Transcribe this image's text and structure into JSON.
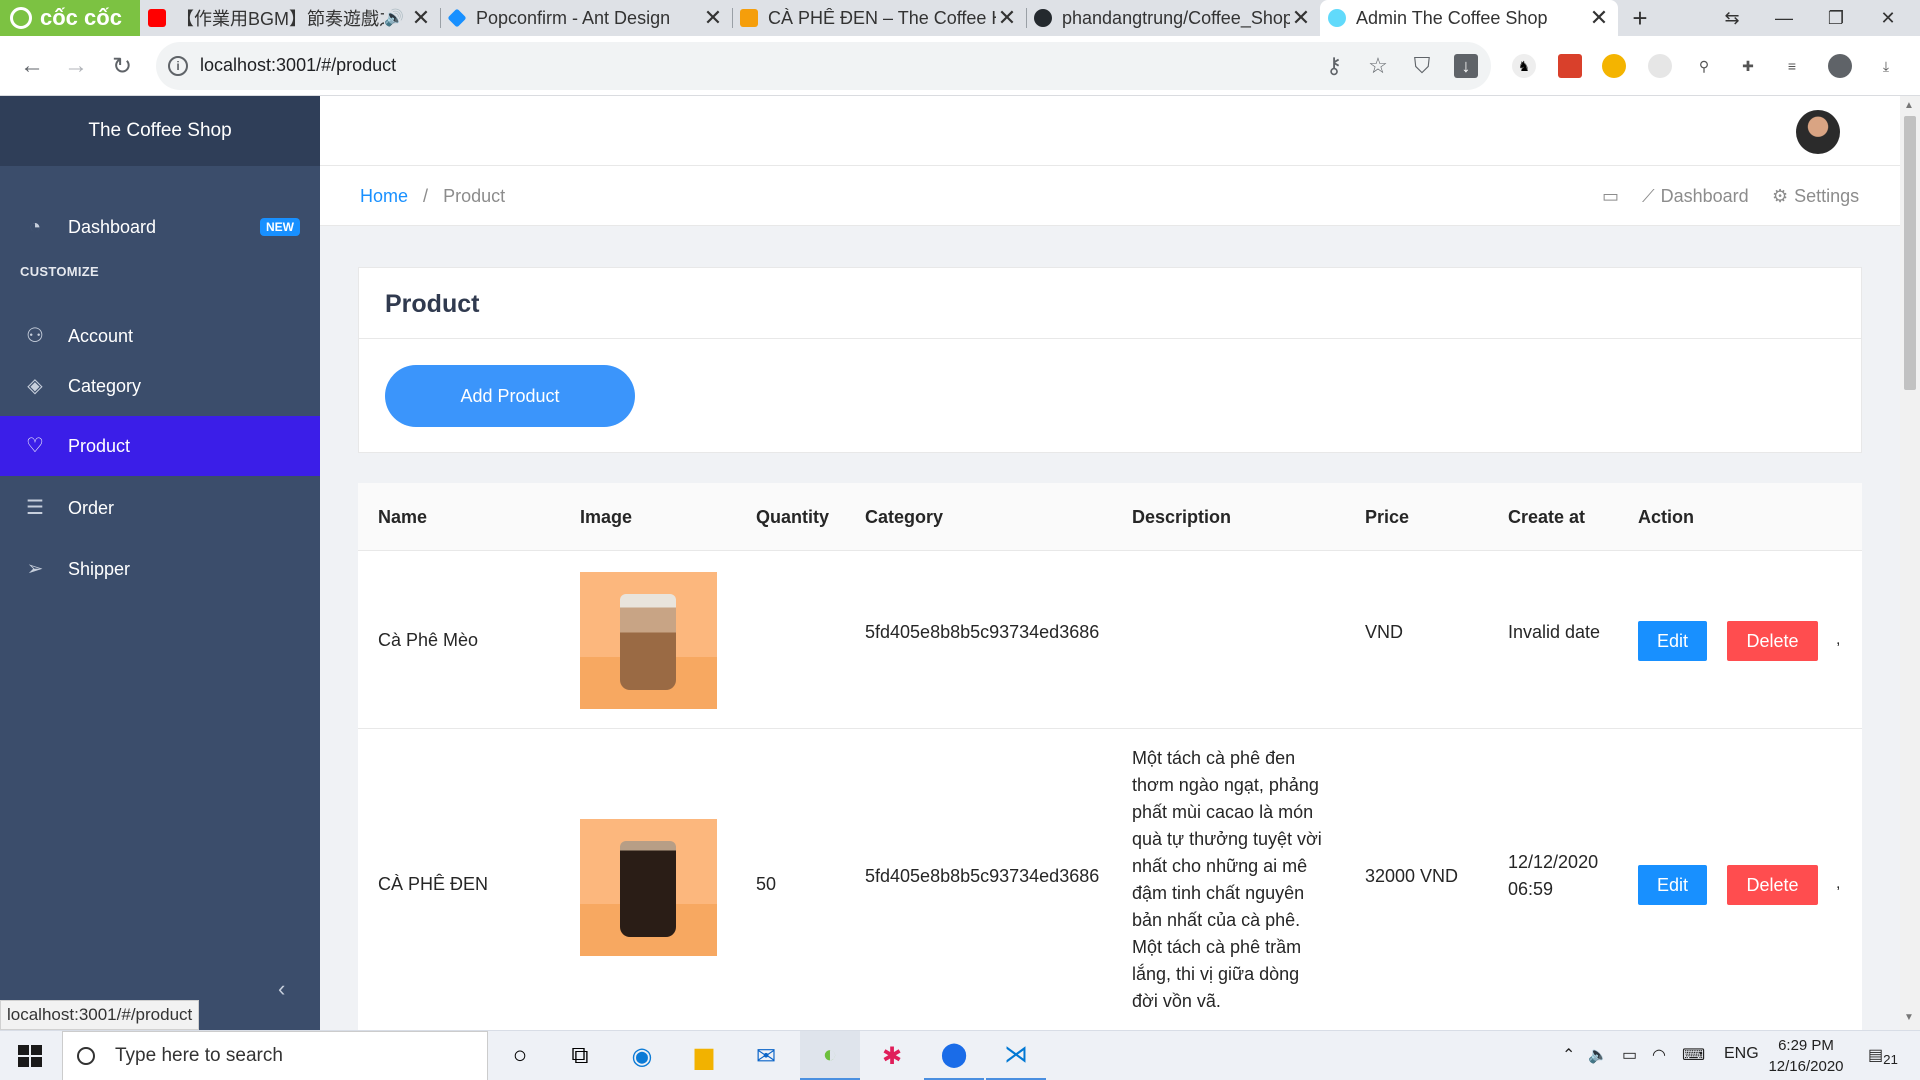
{
  "browser": {
    "brand": "cốc cốc",
    "tabs": [
      {
        "label": "【作業用BGM】節奏遊戲之",
        "favicon_color": "#ff0000"
      },
      {
        "label": "Popconfirm - Ant Design",
        "favicon_color": "#1890ff"
      },
      {
        "label": "CÀ PHÊ ĐEN – The Coffee Ho",
        "favicon_color": "#f59e0b"
      },
      {
        "label": "phandangtrung/Coffee_Shop",
        "favicon_color": "#24292e"
      },
      {
        "label": "Admin The Coffee Shop",
        "favicon_color": "#61dafb"
      }
    ],
    "url": "localhost:3001/#/product",
    "status_url": "localhost:3001/#/product"
  },
  "app": {
    "title": "The Coffee Shop",
    "sidebar": {
      "section_label": "CUSTOMIZE",
      "items": [
        {
          "label": "Dashboard",
          "badge": "NEW",
          "icon": "dashboard-icon"
        },
        {
          "label": "Account",
          "icon": "user-icon"
        },
        {
          "label": "Category",
          "icon": "layers-icon"
        },
        {
          "label": "Product",
          "icon": "product-icon",
          "active": true
        },
        {
          "label": "Order",
          "icon": "list-icon"
        },
        {
          "label": "Shipper",
          "icon": "send-icon"
        }
      ]
    },
    "breadcrumb": {
      "home": "Home",
      "separator": "/",
      "current": "Product"
    },
    "header_links": {
      "dashboard": "Dashboard",
      "settings": "Settings"
    },
    "card": {
      "title": "Product",
      "add_button": "Add Product"
    },
    "table": {
      "columns": [
        "Name",
        "Image",
        "Quantity",
        "Category",
        "Description",
        "Price",
        "Create at",
        "Action"
      ],
      "rows": [
        {
          "name": "Cà Phê Mèo",
          "quantity": "",
          "category": "5fd405e8b8b5c93734ed3686",
          "description": "",
          "price": "VND",
          "created": "Invalid date",
          "created_time": ""
        },
        {
          "name": "CÀ PHÊ ĐEN",
          "quantity": "50",
          "category": "5fd405e8b8b5c93734ed3686",
          "description": [
            "Một tách cà phê đen",
            "thơm ngào ngạt, phảng",
            "phất mùi cacao là món",
            "quà tự thưởng tuyệt vời",
            "nhất cho những ai mê",
            "đậm tinh chất nguyên",
            "bản nhất của cà phê.",
            "Một tách cà phê trầm",
            "lắng, thi vị giữa dòng",
            "đời vồn vã."
          ],
          "price": "32000 VND",
          "created": "12/12/2020",
          "created_time": "06:59"
        }
      ],
      "edit_label": "Edit",
      "delete_label": "Delete",
      "trailing": ","
    }
  },
  "taskbar": {
    "search_placeholder": "Type here to search",
    "language": "ENG",
    "time": "6:29 PM",
    "date": "12/16/2020",
    "notifications": "21"
  },
  "colors": {
    "sidebar_bg": "#3b4d6b",
    "active_item": "#3b1ee8",
    "primary": "#1890ff",
    "danger": "#ff4d4f",
    "add_button": "#3b95fb"
  }
}
